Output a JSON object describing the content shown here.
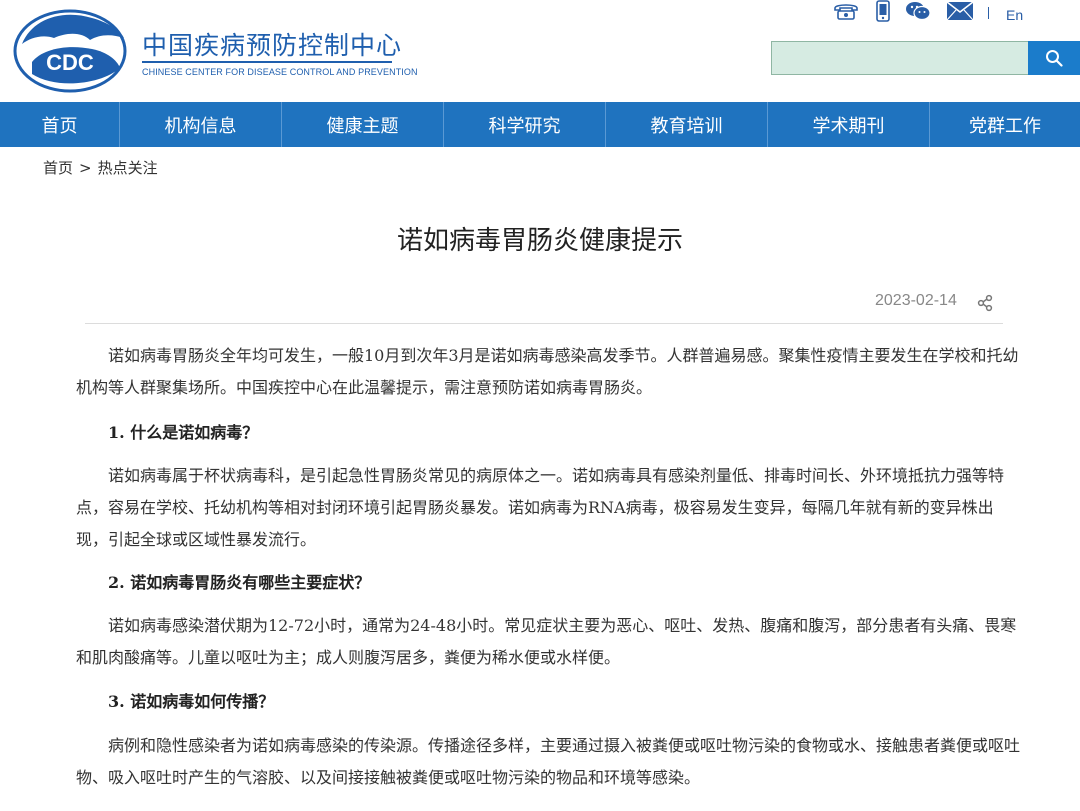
{
  "header": {
    "logo_text": "CDC",
    "brand_cn": "中国疾病预防控制中心",
    "brand_en": "CHINESE CENTER FOR DISEASE CONTROL AND PREVENTION",
    "language_link": "En",
    "search_placeholder": ""
  },
  "icons": {
    "phone": "phone-icon",
    "mobile": "mobile-icon",
    "wechat": "wechat-icon",
    "mail": "mail-icon",
    "search": "search-icon",
    "share": "share-icon"
  },
  "nav": {
    "items": [
      "首页",
      "机构信息",
      "健康主题",
      "科学研究",
      "教育培训",
      "学术期刊",
      "党群工作"
    ]
  },
  "breadcrumb": {
    "home": "首页",
    "separator": ">",
    "current": "热点关注"
  },
  "article": {
    "title": "诺如病毒胃肠炎健康提示",
    "date": "2023-02-14",
    "intro": "诺如病毒胃肠炎全年均可发生，一般10月到次年3月是诺如病毒感染高发季节。人群普遍易感。聚集性疫情主要发生在学校和托幼机构等人群聚集场所。中国疾控中心在此温馨提示，需注意预防诺如病毒胃肠炎。",
    "sections": [
      {
        "heading": "1. 什么是诺如病毒？",
        "body": "诺如病毒属于杯状病毒科，是引起急性胃肠炎常见的病原体之一。诺如病毒具有感染剂量低、排毒时间长、外环境抵抗力强等特点，容易在学校、托幼机构等相对封闭环境引起胃肠炎暴发。诺如病毒为RNA病毒，极容易发生变异，每隔几年就有新的变异株出现，引起全球或区域性暴发流行。"
      },
      {
        "heading": "2. 诺如病毒胃肠炎有哪些主要症状？",
        "body": "诺如病毒感染潜伏期为12-72小时，通常为24-48小时。常见症状主要为恶心、呕吐、发热、腹痛和腹泻，部分患者有头痛、畏寒和肌肉酸痛等。儿童以呕吐为主；成人则腹泻居多，粪便为稀水便或水样便。"
      },
      {
        "heading": "3. 诺如病毒如何传播？",
        "body": "病例和隐性感染者为诺如病毒感染的传染源。传播途径多样，主要通过摄入被粪便或呕吐物污染的食物或水、接触患者粪便或呕吐物、吸入呕吐时产生的气溶胶、以及间接接触被粪便或呕吐物污染的物品和环境等感染。"
      }
    ]
  },
  "colors": {
    "brand_blue": "#1f5fae",
    "nav_bg": "#1f73bf",
    "search_bg": "#d6ebe2",
    "search_btn": "#1b7ccb"
  }
}
